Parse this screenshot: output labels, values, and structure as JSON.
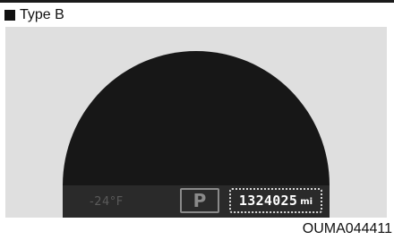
{
  "header": {
    "type_label": "Type B"
  },
  "cluster": {
    "outside_temperature": "-24°F",
    "gear_indicator": "P",
    "odometer": {
      "value": "1324025",
      "unit": "mi"
    }
  },
  "footer": {
    "figure_code": "OUMA044411"
  },
  "colors": {
    "display_background": "#dfdfdf",
    "display_face": "#171717",
    "info_strip": "#2a2a2a",
    "muted_text": "#8a8a8a",
    "odometer_text": "#ffffff"
  },
  "icons": {
    "type_marker": "square-bullet-icon"
  }
}
